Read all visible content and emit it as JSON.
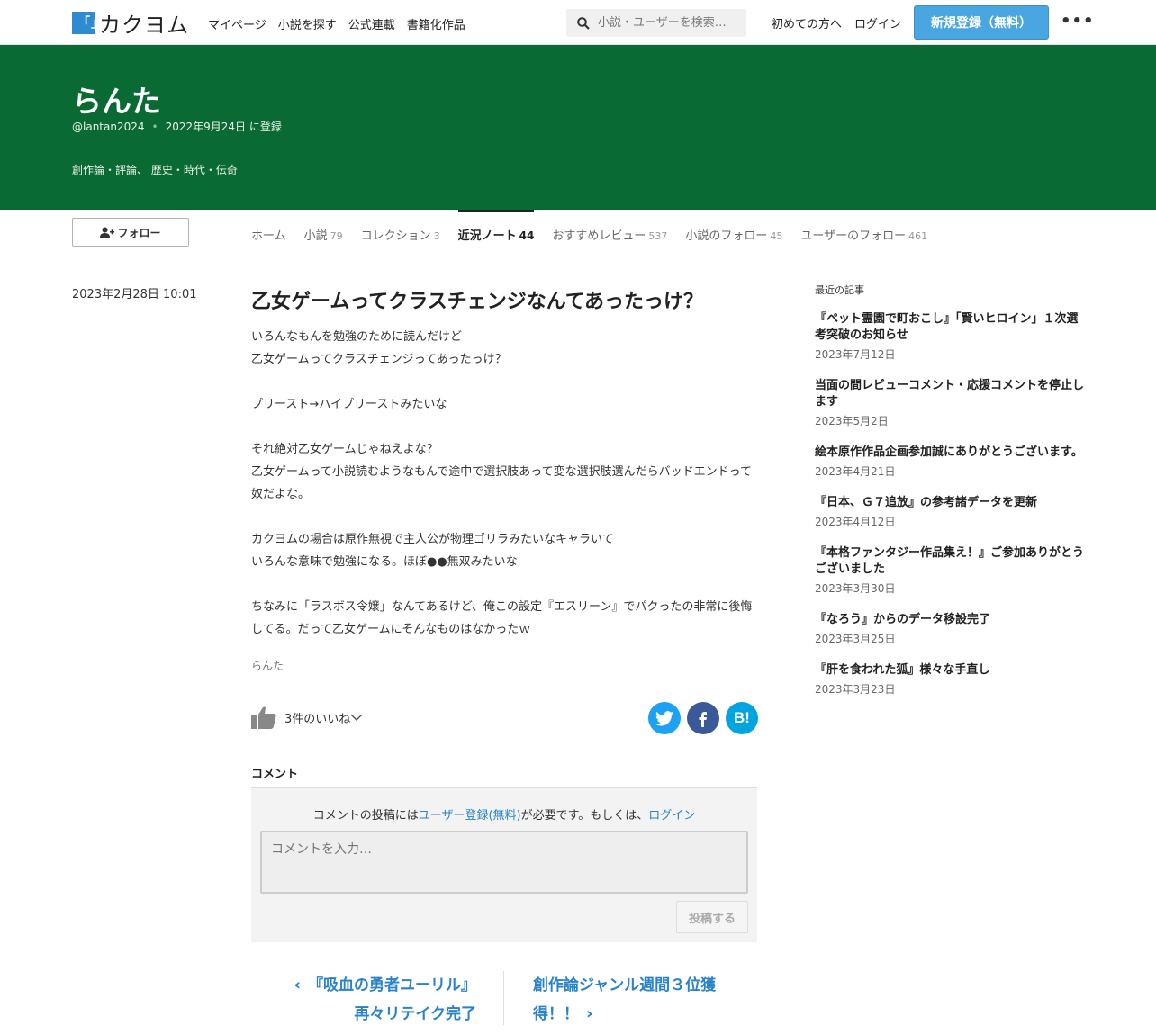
{
  "header": {
    "logo_mark": "「」",
    "logo_text": "カクヨム",
    "nav": [
      "マイページ",
      "小説を探す",
      "公式連載",
      "書籍化作品"
    ],
    "search_placeholder": "小説・ユーザーを検索…",
    "first_time": "初めての方へ",
    "login": "ログイン",
    "signup": "新規登録（無料）",
    "more": "•••"
  },
  "profile": {
    "name": "らんた",
    "handle": "@lantan2024",
    "registered": "2022年9月24日 に登録",
    "genres": "創作論・評論、 歴史・時代・伝奇",
    "follow_label": "フォロー"
  },
  "tabs": [
    {
      "label": "ホーム",
      "count": ""
    },
    {
      "label": "小説",
      "count": "79"
    },
    {
      "label": "コレクション",
      "count": "3"
    },
    {
      "label": "近況ノート",
      "count": "44"
    },
    {
      "label": "おすすめレビュー",
      "count": "537"
    },
    {
      "label": "小説のフォロー",
      "count": "45"
    },
    {
      "label": "ユーザーのフォロー",
      "count": "461"
    }
  ],
  "post": {
    "date": "2023年2月28日 10:01",
    "title": "乙女ゲームってクラスチェンジなんてあったっけ？",
    "paragraphs": [
      "いろんなもんを勉強のために読んだけど\n乙女ゲームってクラスチェンジってあったっけ？",
      "プリースト→ハイプリーストみたいな",
      "それ絶対乙女ゲームじゃねえよな？\n乙女ゲームって小説読むようなもんで途中で選択肢あって変な選択肢選んだらバッドエンドって奴だよな。",
      "カクヨムの場合は原作無視で主人公が物理ゴリラみたいなキャラいて\nいろんな意味で勉強になる。ほぼ●●無双みたいな",
      "ちなみに「ラスボス令嬢」なんてあるけど、俺この設定『エスリーン』でパクったの非常に後悔してる。だって乙女ゲームにそんなものはなかったｗ"
    ],
    "author": "らんた",
    "likes": "3件のいいね",
    "share_hatena": "B!"
  },
  "comment": {
    "heading": "コメント",
    "msg_pre": "コメントの投稿には",
    "msg_link1": "ユーザー登録(無料)",
    "msg_mid": "が必要です。もしくは、",
    "msg_link2": "ログイン",
    "placeholder": "コメントを入力…",
    "submit": "投稿する"
  },
  "pager": {
    "prev_line1": "『吸血の勇者ユーリル』",
    "prev_line2": "再々リテイク完了",
    "next_line1": "創作論ジャンル週間３位獲",
    "next_line2": "得！！"
  },
  "sidebar": {
    "heading": "最近の記事",
    "articles": [
      {
        "title": "『ペット霊園で町おこし』「賢いヒロイン」１次選考突破のお知らせ",
        "date": "2023年7月12日"
      },
      {
        "title": "当面の間レビューコメント・応援コメントを停止します",
        "date": "2023年5月2日"
      },
      {
        "title": "絵本原作作品企画参加誠にありがとうございます。",
        "date": "2023年4月21日"
      },
      {
        "title": "『日本、Ｇ７追放』の参考諸データを更新",
        "date": "2023年4月12日"
      },
      {
        "title": "『本格ファンタジー作品集え！』ご参加ありがとうございました",
        "date": "2023年3月30日"
      },
      {
        "title": "『なろう』からのデータ移設完了",
        "date": "2023年3月25日"
      },
      {
        "title": "『肝を食われた狐』様々な手直し",
        "date": "2023年3月23日"
      }
    ]
  },
  "colors": {
    "banner": "#0a6a33",
    "accent": "#4aa6e0",
    "link": "#2a83c9",
    "twitter": "#1da1f2",
    "facebook": "#3b5998",
    "hatena": "#00a4de"
  }
}
